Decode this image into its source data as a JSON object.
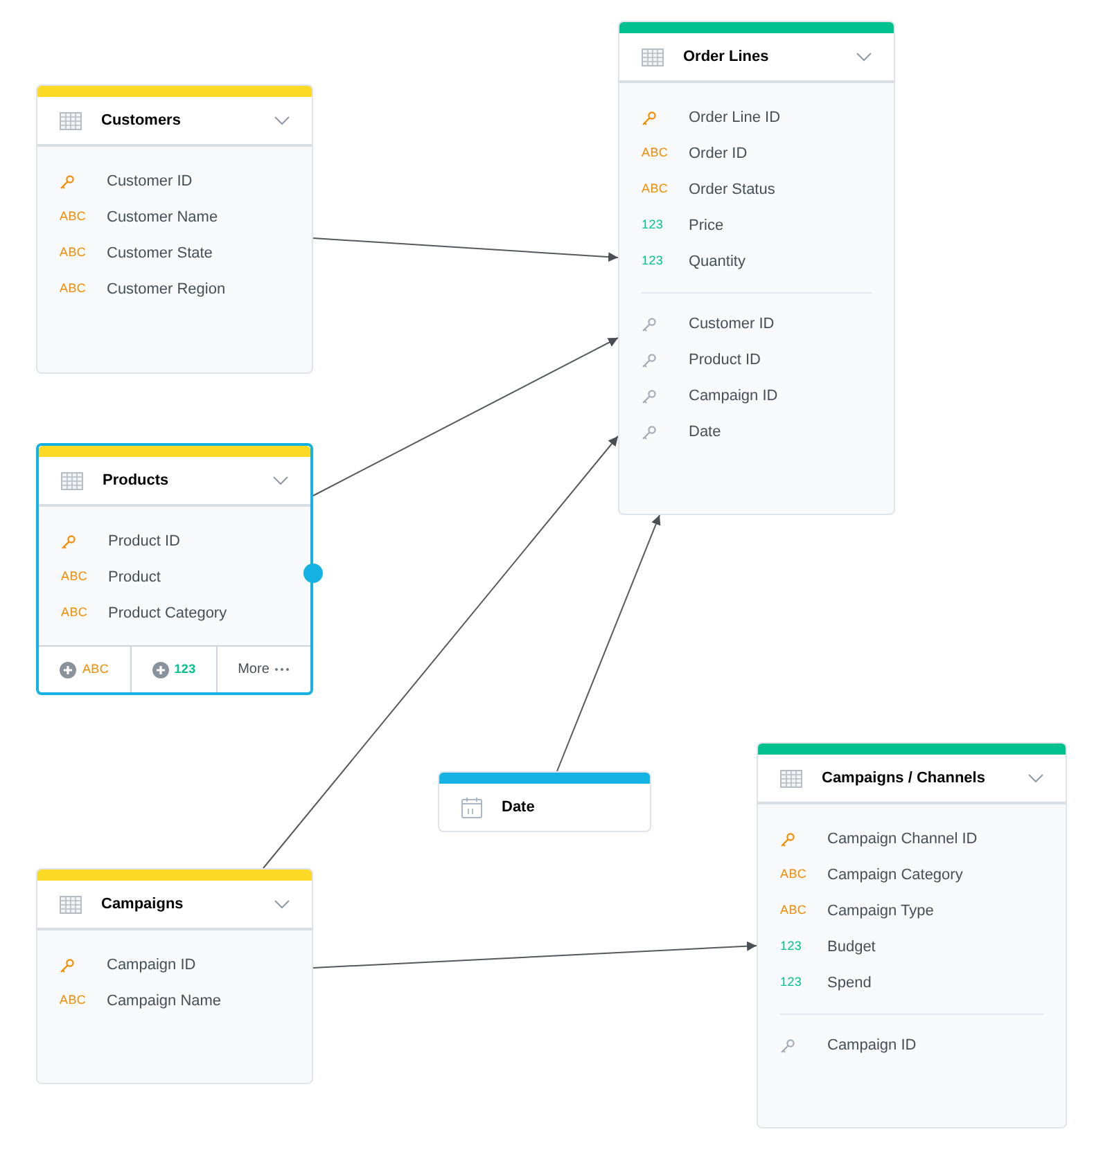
{
  "tables": [
    {
      "kind": "table",
      "title": "Customers",
      "color": "#fcd924",
      "selected": false,
      "groups": [
        [
          {
            "kind": "key",
            "name": "Customer ID"
          },
          {
            "kind": "text",
            "badge": "ABC",
            "name": "Customer Name"
          },
          {
            "kind": "text",
            "badge": "ABC",
            "name": "Customer State"
          },
          {
            "kind": "text",
            "badge": "ABC",
            "name": "Customer Region"
          }
        ]
      ]
    },
    {
      "kind": "table",
      "title": "Products",
      "color": "#fcd924",
      "selected": true,
      "groups": [
        [
          {
            "kind": "key",
            "name": "Product ID"
          },
          {
            "kind": "text",
            "badge": "ABC",
            "name": "Product"
          },
          {
            "kind": "text",
            "badge": "ABC",
            "name": "Product Category"
          }
        ]
      ],
      "actions": [
        {
          "kind": "add-text",
          "label": "ABC"
        },
        {
          "kind": "add-number",
          "label": "123"
        },
        {
          "kind": "more",
          "label": "More"
        }
      ]
    },
    {
      "kind": "table",
      "title": "Order Lines",
      "color": "#00c18d",
      "selected": false,
      "groups": [
        [
          {
            "kind": "key",
            "name": "Order Line ID"
          },
          {
            "kind": "text",
            "badge": "ABC",
            "name": "Order ID"
          },
          {
            "kind": "text",
            "badge": "ABC",
            "name": "Order Status"
          },
          {
            "kind": "number",
            "badge": "123",
            "name": "Price"
          },
          {
            "kind": "number",
            "badge": "123",
            "name": "Quantity"
          }
        ],
        [
          {
            "kind": "reference",
            "name": "Customer ID"
          },
          {
            "kind": "reference",
            "name": "Product ID"
          },
          {
            "kind": "reference",
            "name": "Campaign ID"
          },
          {
            "kind": "reference",
            "name": "Date"
          }
        ]
      ]
    },
    {
      "kind": "date",
      "title": "Date",
      "color": "#14b2e2",
      "selected": false
    },
    {
      "kind": "table",
      "title": "Campaigns",
      "color": "#fcd924",
      "selected": false,
      "groups": [
        [
          {
            "kind": "key",
            "name": "Campaign ID"
          },
          {
            "kind": "text",
            "badge": "ABC",
            "name": "Campaign Name"
          }
        ]
      ]
    },
    {
      "kind": "table",
      "title": "Campaigns / Channels",
      "color": "#00c18d",
      "selected": false,
      "groups": [
        [
          {
            "kind": "key",
            "name": "Campaign Channel ID"
          },
          {
            "kind": "text",
            "badge": "ABC",
            "name": "Campaign Category"
          },
          {
            "kind": "text",
            "badge": "ABC",
            "name": "Campaign Type"
          },
          {
            "kind": "number",
            "badge": "123",
            "name": "Budget"
          },
          {
            "kind": "number",
            "badge": "123",
            "name": "Spend"
          }
        ],
        [
          {
            "kind": "reference",
            "name": "Campaign ID"
          }
        ]
      ]
    }
  ]
}
